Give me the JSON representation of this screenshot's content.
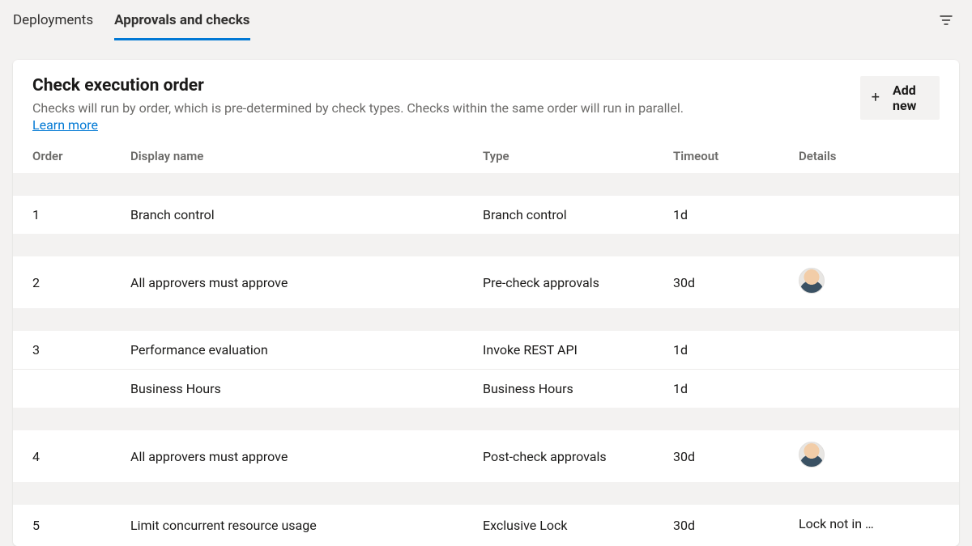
{
  "tabs": [
    {
      "label": "Deployments",
      "active": false
    },
    {
      "label": "Approvals and checks",
      "active": true
    }
  ],
  "header": {
    "title": "Check execution order",
    "description": "Checks will run by order, which is pre-determined by check types. Checks within the same order will run in parallel.",
    "learn_more": "Learn more",
    "add_new_label": "Add new"
  },
  "columns": {
    "order": "Order",
    "display_name": "Display name",
    "type": "Type",
    "timeout": "Timeout",
    "details": "Details"
  },
  "rows": [
    {
      "order": "1",
      "name": "Branch control",
      "type": "Branch control",
      "timeout": "1d",
      "details": "",
      "avatar": false,
      "spacer_before": true
    },
    {
      "order": "2",
      "name": "All approvers must approve",
      "type": "Pre-check approvals",
      "timeout": "30d",
      "details": "",
      "avatar": true,
      "spacer_before": true
    },
    {
      "order": "3",
      "name": "Performance evaluation",
      "type": "Invoke REST API",
      "timeout": "1d",
      "details": "",
      "avatar": false,
      "spacer_before": true
    },
    {
      "order": "",
      "name": "Business Hours",
      "type": "Business Hours",
      "timeout": "1d",
      "details": "",
      "avatar": false,
      "spacer_before": false
    },
    {
      "order": "4",
      "name": "All approvers must approve",
      "type": "Post-check approvals",
      "timeout": "30d",
      "details": "",
      "avatar": true,
      "spacer_before": true
    },
    {
      "order": "5",
      "name": "Limit concurrent resource usage",
      "type": "Exclusive Lock",
      "timeout": "30d",
      "details": "Lock not in …",
      "avatar": false,
      "spacer_before": true
    }
  ]
}
